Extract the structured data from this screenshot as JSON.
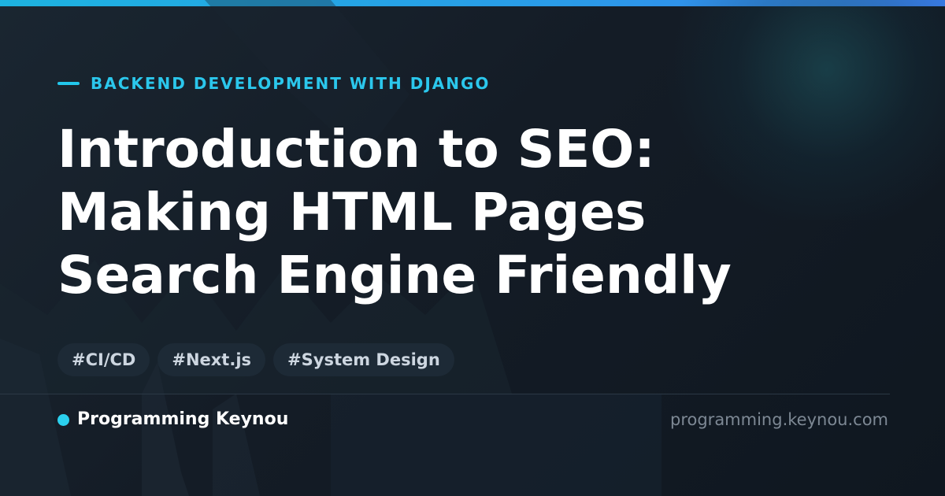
{
  "card": {
    "category": "BACKEND DEVELOPMENT WITH DJANGO",
    "title_lines": [
      "Introduction to SEO:",
      "Making HTML Pages",
      "Search Engine Friendly"
    ],
    "tags": [
      "#CI/CD",
      "#Next.js",
      "#System Design"
    ],
    "brand_name": "Programming Keynou",
    "site_url": "programming.keynou.com"
  },
  "colors": {
    "accent": "#22c7ec",
    "background": "#141c26",
    "title": "#ffffff",
    "tag_background": "#1d2a36",
    "url_text": "#7d8894"
  },
  "icons": {
    "eyebrow": "accent-line-icon",
    "brand": "status-dot-icon"
  }
}
